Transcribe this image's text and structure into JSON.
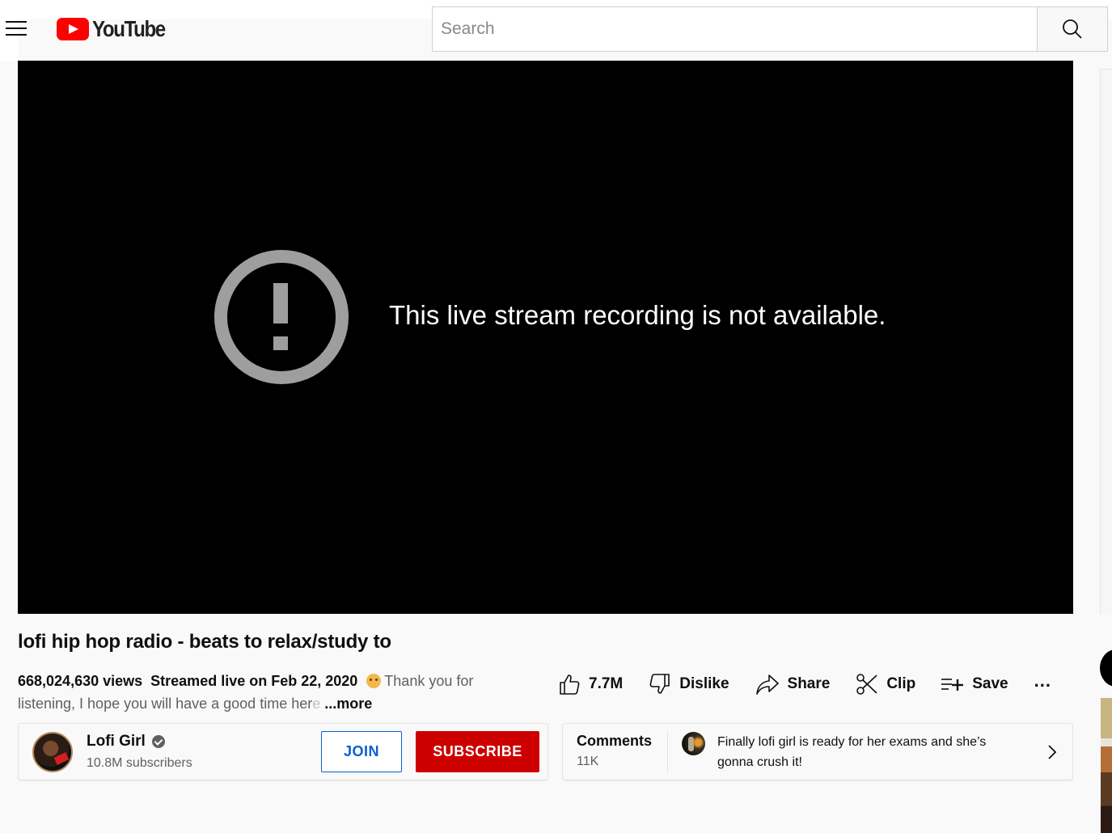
{
  "header": {
    "logo_text": "YouTube",
    "search_placeholder": "Search",
    "search_value": "",
    "icons": {
      "menu": "hamburger-menu-icon",
      "logo": "youtube-play-icon",
      "search": "search-icon"
    }
  },
  "player": {
    "error_message": "This live stream recording is not available.",
    "error_icon": "alert-circle-icon"
  },
  "video": {
    "title": "lofi hip hop radio - beats to relax/study to",
    "views": "668,024,630 views",
    "stream_date": "Streamed live on Feb 22, 2020",
    "description_line1": "Thank you for",
    "description_line2": "listening, I hope you will have a good time her",
    "description_fade": "e",
    "more_label": "...more"
  },
  "actions": {
    "like_count": "7.7M",
    "dislike_label": "Dislike",
    "share_label": "Share",
    "clip_label": "Clip",
    "save_label": "Save",
    "more_label": "..."
  },
  "channel": {
    "name": "Lofi Girl",
    "verified": true,
    "subscribers": "10.8M subscribers",
    "join_label": "JOIN",
    "subscribe_label": "SUBSCRIBE"
  },
  "comments": {
    "label": "Comments",
    "count": "11K",
    "top_comment": "Finally lofi girl is ready for her exams and she’s gonna crush it!"
  },
  "colors": {
    "brand_red": "#ff0000",
    "subscribe_red": "#cc0000",
    "join_blue": "#065fd4",
    "player_bg": "#000000",
    "error_icon_gray": "#9e9e9e",
    "page_bg": "#f9f9f9"
  }
}
